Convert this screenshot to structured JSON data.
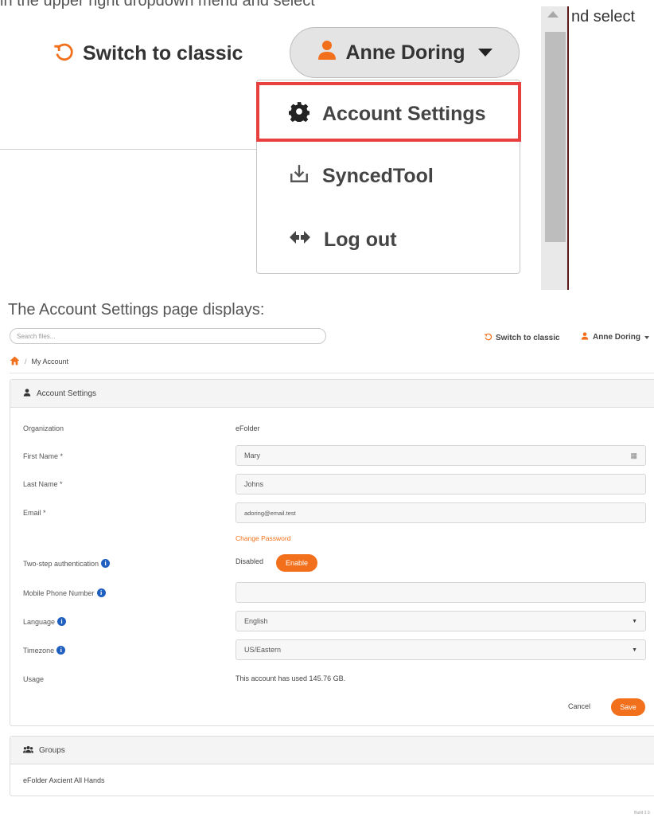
{
  "top_crop": {
    "cut_text_left": "in the upper right dropdown menu and select",
    "cut_text_right": "nd select",
    "switch_label": "Switch to classic",
    "user_name": "Anne Doring",
    "menu": [
      {
        "label": "Account Settings",
        "icon": "gear-icon"
      },
      {
        "label": "SyncedTool",
        "icon": "download-tray-icon"
      },
      {
        "label": "Log out",
        "icon": "logout-arrows-icon"
      }
    ],
    "highlight_color": "#e8403f"
  },
  "caption": "The Account Settings page displays:",
  "page": {
    "search_placeholder": "Search files...",
    "switch_label": "Switch to classic",
    "user_name": "Anne Doring",
    "breadcrumb": "My Account",
    "accent_color": "#f2701c",
    "account_panel": {
      "title": "Account Settings",
      "organization_label": "Organization",
      "organization_value": "eFolder",
      "first_name_label": "First Name *",
      "first_name_value": "Mary",
      "last_name_label": "Last Name *",
      "last_name_value": "Johns",
      "email_label": "Email *",
      "email_value": "adoring@email.test",
      "change_password": "Change Password",
      "two_step_label": "Two-step authentication",
      "two_step_status": "Disabled",
      "enable_button": "Enable",
      "mobile_label": "Mobile Phone Number",
      "mobile_value": "",
      "language_label": "Language",
      "language_value": "English",
      "timezone_label": "Timezone",
      "timezone_value": "US/Eastern",
      "usage_label": "Usage",
      "usage_value": "This account has used 145.76 GB.",
      "cancel_button": "Cancel",
      "save_button": "Save"
    },
    "groups_panel": {
      "title": "Groups",
      "items": [
        "eFolder Axcient All Hands"
      ]
    },
    "footer": "Build 3.9."
  }
}
